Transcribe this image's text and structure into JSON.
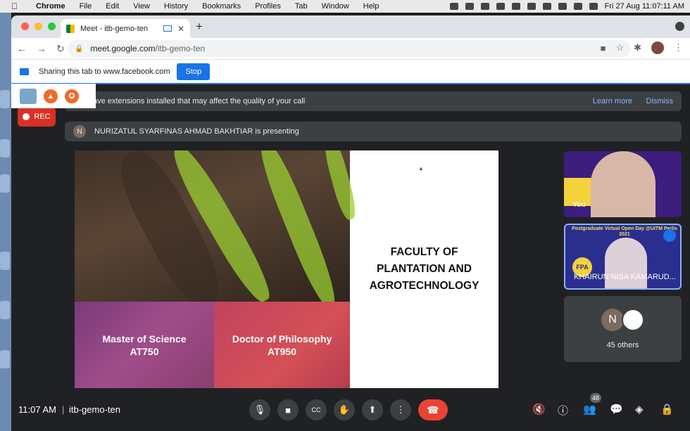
{
  "menubar": {
    "app": "Chrome",
    "items": [
      "File",
      "Edit",
      "View",
      "History",
      "Bookmarks",
      "Profiles",
      "Tab",
      "Window",
      "Help"
    ],
    "clock": "Fri 27 Aug  11:07:11 AM"
  },
  "browser": {
    "tab_title": "Meet - itb-gemo-ten",
    "url_host": "meet.google.com",
    "url_path": "/itb-gemo-ten",
    "share_text": "Sharing this tab to www.facebook.com",
    "stop_label": "Stop"
  },
  "meet": {
    "banner_text": "ave extensions installed that may affect the quality of your call",
    "learn_more": "Learn more",
    "dismiss": "Dismiss",
    "rec_label": "REC",
    "presenter_initial": "N",
    "presenter_text": "NURIZATUL SYARFINAS AHMAD BAKHTIAR is presenting",
    "slide": {
      "msc_line1": "Master of Science",
      "msc_line2": "AT750",
      "phd_line1": "Doctor of Philosophy",
      "phd_line2": "AT950",
      "faculty_line1": "FACULTY OF",
      "faculty_line2": "PLANTATION AND",
      "faculty_line3": "AGROTECHNOLOGY"
    },
    "tiles": {
      "self_label": "You",
      "speaker_name": "KHAIRUN NISA KAMARUD...",
      "speaker_header": "Postgraduate Virtual Open Day @UiTM Perlis 2021",
      "fpa": "FPA",
      "others_initial": "N",
      "others_count": "45 others"
    },
    "bottom": {
      "time": "11:07 AM",
      "separator": "|",
      "meeting_code": "itb-gemo-ten",
      "participants_badge": "48"
    }
  }
}
